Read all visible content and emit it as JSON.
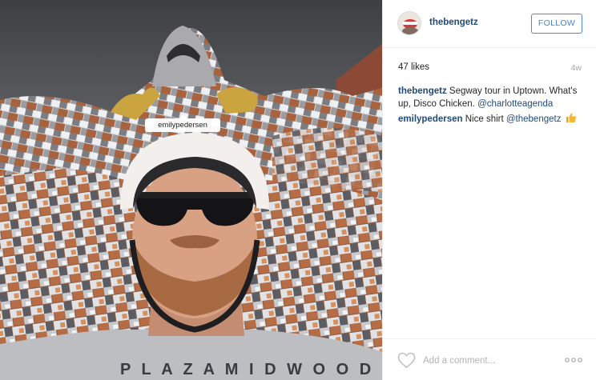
{
  "photo": {
    "tag_label": "emilypedersen",
    "shirt_text": "P L A Z A   M I D W O O D"
  },
  "post": {
    "username": "thebengetz",
    "follow_label": "FOLLOW",
    "likes": "47 likes",
    "age": "4w"
  },
  "comments": [
    {
      "user": "thebengetz",
      "text": " Segway tour in Uptown. What's up, Disco Chicken. ",
      "mention": "@charlotteagenda"
    },
    {
      "user": "emilypedersen",
      "text": " Nice shirt ",
      "mention": "@thebengetz",
      "emoji": "thumbs-up-icon"
    }
  ],
  "footer": {
    "add_comment_placeholder": "Add a comment...",
    "icons": [
      "heart-icon",
      "more-options-icon"
    ]
  },
  "colors": {
    "username": "#1f4b7a",
    "follow_border": "#4c8ad4",
    "follow_text": "#3f86cc",
    "muted": "#a5a7aa",
    "thumbs_up": "#f5b82e"
  }
}
